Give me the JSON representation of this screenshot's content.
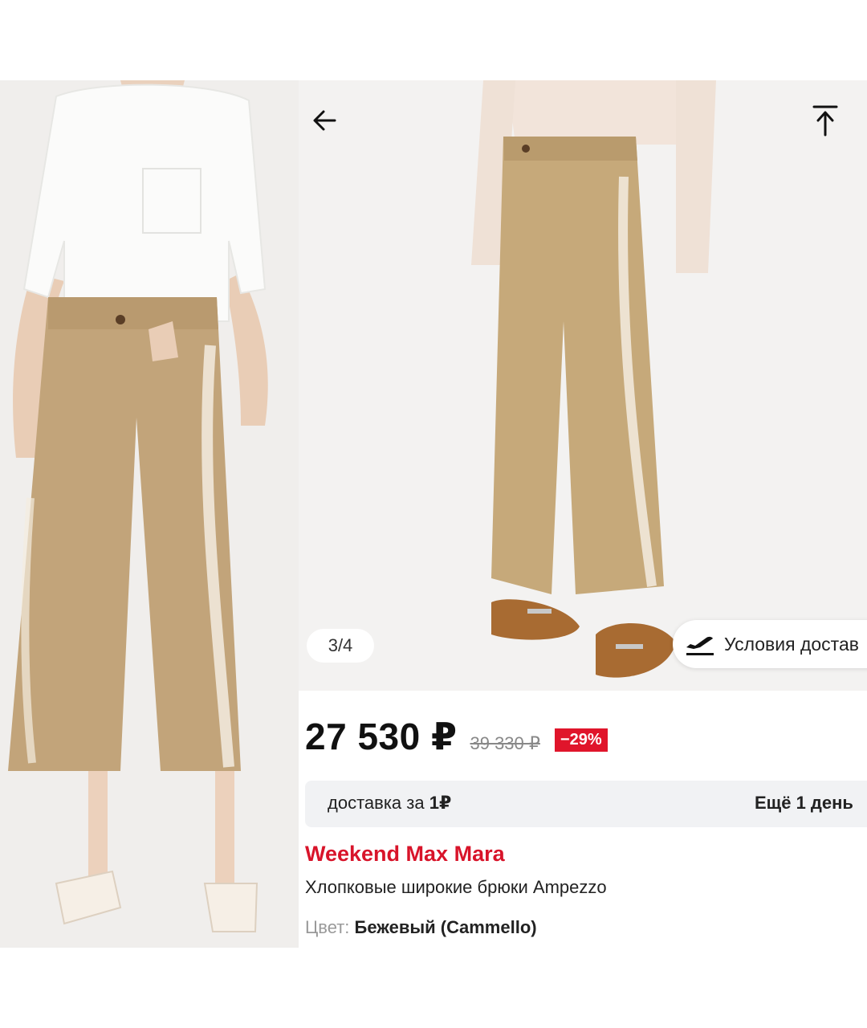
{
  "gallery": {
    "counter": "3/4",
    "delivery_terms_label": "Условия достав"
  },
  "product": {
    "price": "27 530 ₽",
    "old_price": "39 330 ₽",
    "discount": "−29%",
    "delivery_label": "доставка за ",
    "delivery_cost": "1₽",
    "delivery_time": "Ещё 1 день",
    "brand": "Weekend Max Mara",
    "title": "Хлопковые широкие брюки Ampezzo",
    "color_label": "Цвет: ",
    "color_value": "Бежевый (Cammello)"
  },
  "icons": {
    "back": "arrow-left-icon",
    "scroll_top": "arrow-to-top-icon",
    "plane": "airplane-departure-icon"
  },
  "colors": {
    "brand": "#d8142a",
    "discount_bg": "#e0152b",
    "pants": "#c2a47a",
    "shirt": "#fbfbfa"
  }
}
